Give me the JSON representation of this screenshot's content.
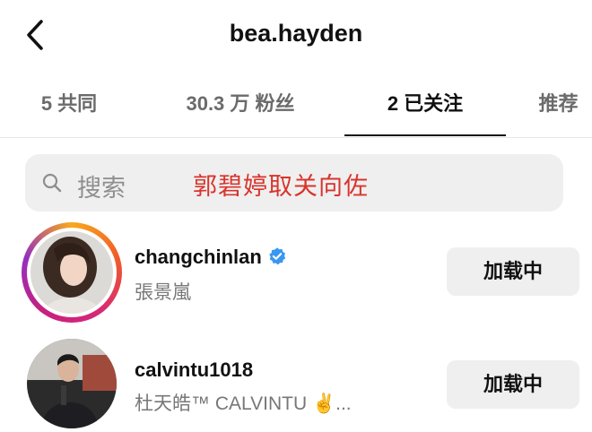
{
  "header": {
    "title": "bea.hayden",
    "back_icon": "chevron-left-icon"
  },
  "tabs": [
    {
      "label": "5 共同",
      "active": false
    },
    {
      "label": "30.3 万 粉丝",
      "active": false
    },
    {
      "label": "2 已关注",
      "active": true
    },
    {
      "label": "推荐",
      "active": false
    }
  ],
  "search": {
    "placeholder": "搜索",
    "icon": "search-icon"
  },
  "overlay_caption": "郭碧婷取关向佐",
  "following": [
    {
      "username": "changchinlan",
      "verified": true,
      "full_name": "張景嵐",
      "has_story_ring": true,
      "button_label": "加载中"
    },
    {
      "username": "calvintu1018",
      "verified": false,
      "full_name": "杜天皓™ CALVINTU ✌️...",
      "has_story_ring": false,
      "button_label": "加载中"
    }
  ],
  "colors": {
    "caption": "#d8342c",
    "verified": "#3897f0",
    "button_bg": "#efefef"
  }
}
